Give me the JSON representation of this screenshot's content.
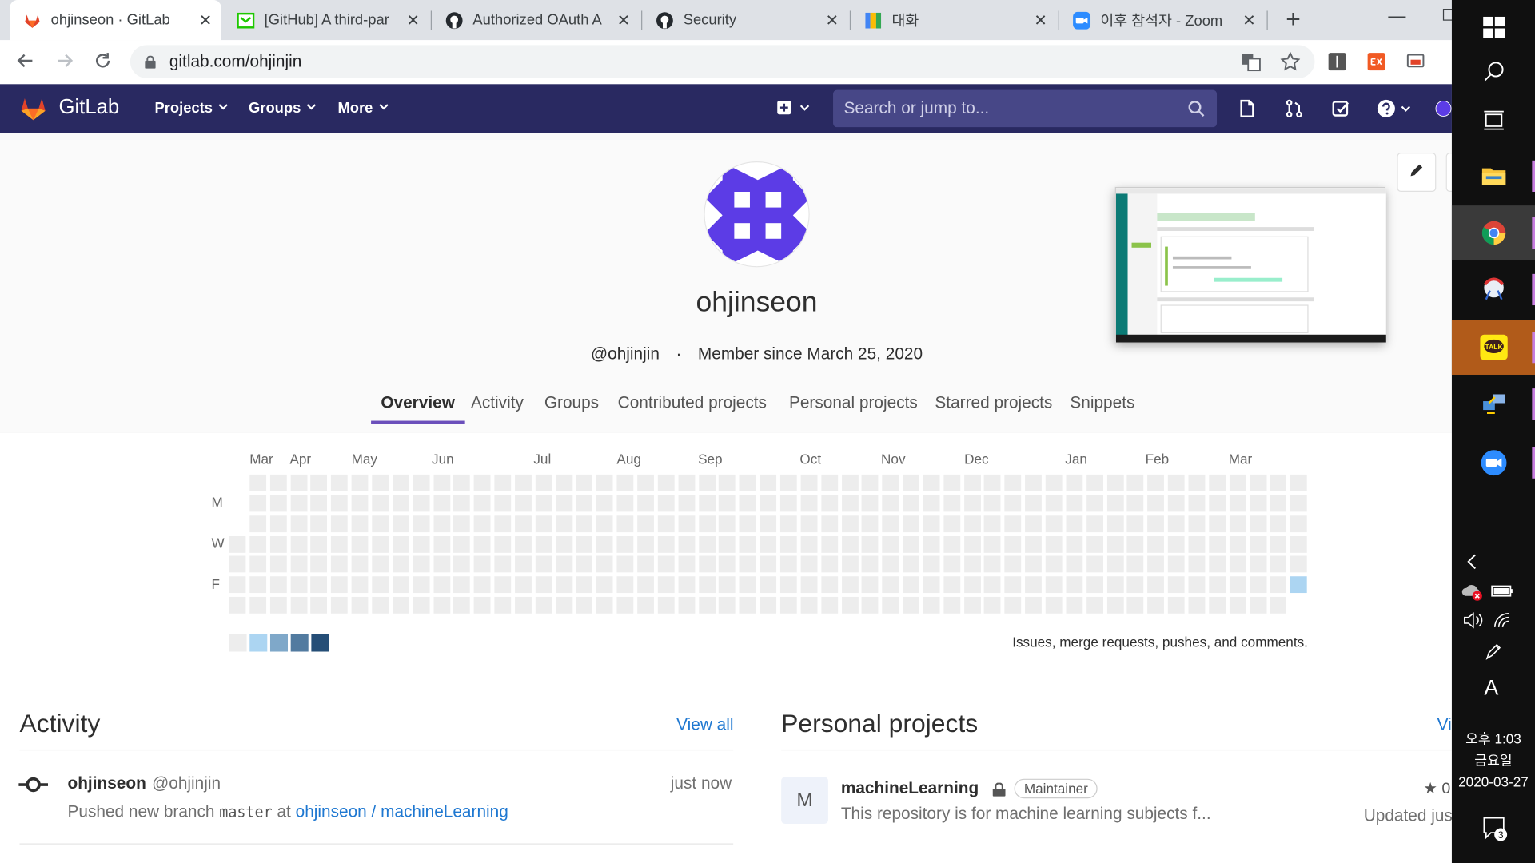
{
  "browser": {
    "tabs": [
      {
        "label": "ohjinseon · GitLab",
        "icon": "gitlab-fox-icon",
        "active": true
      },
      {
        "label": "[GitHub] A third-par",
        "icon": "mail-icon",
        "active": false
      },
      {
        "label": "Authorized OAuth A",
        "icon": "github-icon",
        "active": false
      },
      {
        "label": "Security",
        "icon": "github-icon",
        "active": false
      },
      {
        "label": "대화",
        "icon": "chat-icon",
        "active": false
      },
      {
        "label": "이후 참석자 - Zoom",
        "icon": "zoom-icon",
        "active": false
      }
    ],
    "close_glyph": "✕",
    "new_tab_glyph": "+",
    "url": "gitlab.com/ohjinjin"
  },
  "gitlab_header": {
    "brand": "GitLab",
    "nav": [
      {
        "label": "Projects"
      },
      {
        "label": "Groups"
      },
      {
        "label": "More"
      }
    ],
    "search_placeholder": "Search or jump to..."
  },
  "profile": {
    "name": "ohjinseon",
    "handle": "@ohjinjin",
    "separator": "·",
    "member_since": "Member since March 25, 2020",
    "tabs": [
      {
        "label": "Overview",
        "active": true
      },
      {
        "label": "Activity",
        "active": false
      },
      {
        "label": "Groups",
        "active": false
      },
      {
        "label": "Contributed projects",
        "active": false
      },
      {
        "label": "Personal projects",
        "active": false
      },
      {
        "label": "Starred projects",
        "active": false
      },
      {
        "label": "Snippets",
        "active": false
      }
    ]
  },
  "calendar": {
    "months": [
      "Mar",
      "Apr",
      "May",
      "Jun",
      "Jul",
      "Aug",
      "Sep",
      "Oct",
      "Nov",
      "Dec",
      "Jan",
      "Feb",
      "Mar"
    ],
    "day_labels": [
      "M",
      "W",
      "F"
    ],
    "note": "Issues, merge requests, pushes, and comments.",
    "active_cell": {
      "week": 52,
      "day": 5,
      "level": 1
    },
    "legend_colors": [
      "#ededed",
      "#acd5f2",
      "#7fa8c9",
      "#527ba0",
      "#254e77"
    ]
  },
  "activity": {
    "title": "Activity",
    "view_all": "View all",
    "items": [
      {
        "user": "ohjinseon",
        "handle": "@ohjinjin",
        "time": "just now",
        "action": "Pushed new branch",
        "branch": "master",
        "at": "at",
        "project": "ohjinseon / machineLearning"
      }
    ]
  },
  "personal_projects": {
    "title": "Personal projects",
    "view_all": "Vi",
    "items": [
      {
        "avatar_letter": "M",
        "name": "machineLearning",
        "badge": "Maintainer",
        "description": "This repository is for machine learning subjects f...",
        "star": "★ 0",
        "updated": "Updated jus"
      }
    ]
  },
  "taskbar": {
    "clock_period_time": "오후 1:03",
    "clock_day": "금요일",
    "clock_date": "2020-03-27",
    "ime": "A",
    "notification_count": "3",
    "kakao_label": "TALK"
  },
  "colors": {
    "gitlab_header": "#292961",
    "accent_purple": "#6b4fbb",
    "link_blue": "#1f78d1",
    "avatar_purple": "#5c3ce6"
  }
}
